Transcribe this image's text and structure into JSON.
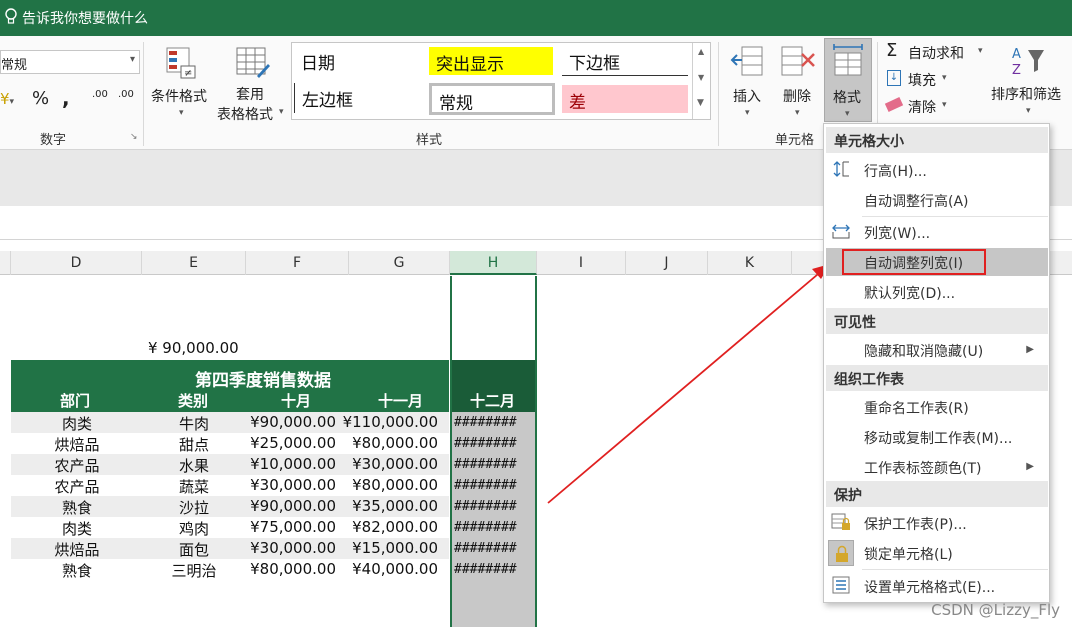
{
  "tellme": {
    "text": "告诉我你想要做什么"
  },
  "ribbon": {
    "number_group": {
      "format_value": "常规",
      "currency_symbol": "¥",
      "percent_symbol": "%",
      "comma_symbol": ",",
      "inc_decimal": ".00",
      "dec_decimal": ".00",
      "label": "数字"
    },
    "styles_group": {
      "conditional_format": "条件格式",
      "table_format_line1": "套用",
      "table_format_line2": "表格格式",
      "gallery": [
        "日期",
        "突出显示",
        "下边框",
        "左边框",
        "常规",
        "差"
      ],
      "label": "样式"
    },
    "cells_group": {
      "insert": "插入",
      "delete": "删除",
      "format": "格式",
      "label": "单元格"
    },
    "editing_group": {
      "autosum": "自动求和",
      "fill": "填充",
      "clear": "清除",
      "sort_filter": "排序和筛选"
    }
  },
  "columns": [
    "D",
    "E",
    "F",
    "G",
    "H",
    "I",
    "J",
    "K"
  ],
  "sheet": {
    "total": "¥ 90,000.00",
    "title": "第四季度销售数据",
    "headers": [
      "部门",
      "类别",
      "十月",
      "十一月",
      "十二月"
    ],
    "rows": [
      [
        "肉类",
        "牛肉",
        "¥90,000.00",
        "¥110,000.00",
        "########"
      ],
      [
        "烘焙品",
        "甜点",
        "¥25,000.00",
        "¥80,000.00",
        "########"
      ],
      [
        "农产品",
        "水果",
        "¥10,000.00",
        "¥30,000.00",
        "########"
      ],
      [
        "农产品",
        "蔬菜",
        "¥30,000.00",
        "¥80,000.00",
        "########"
      ],
      [
        "熟食",
        "沙拉",
        "¥90,000.00",
        "¥35,000.00",
        "########"
      ],
      [
        "肉类",
        "鸡肉",
        "¥75,000.00",
        "¥82,000.00",
        "########"
      ],
      [
        "烘焙品",
        "面包",
        "¥30,000.00",
        "¥15,000.00",
        "########"
      ],
      [
        "熟食",
        "三明治",
        "¥80,000.00",
        "¥40,000.00",
        "########"
      ]
    ]
  },
  "menu": {
    "sec_size": "单元格大小",
    "row_height": "行高(H)...",
    "autofit_row": "自动调整行高(A)",
    "col_width": "列宽(W)...",
    "autofit_col": "自动调整列宽(I)",
    "default_width": "默认列宽(D)...",
    "sec_visibility": "可见性",
    "hide_unhide": "隐藏和取消隐藏(U)",
    "sec_organize": "组织工作表",
    "rename": "重命名工作表(R)",
    "move_copy": "移动或复制工作表(M)...",
    "tab_color": "工作表标签颜色(T)",
    "sec_protect": "保护",
    "protect_sheet": "保护工作表(P)...",
    "lock_cell": "锁定单元格(L)",
    "format_cells": "设置单元格格式(E)..."
  },
  "watermark": "CSDN @Lizzy_Fly",
  "colors": {
    "excel_green": "#217346",
    "highlight_yellow": "#ffff00",
    "bad_pink": "#ffc7ce",
    "annotation_red": "#e02020"
  }
}
